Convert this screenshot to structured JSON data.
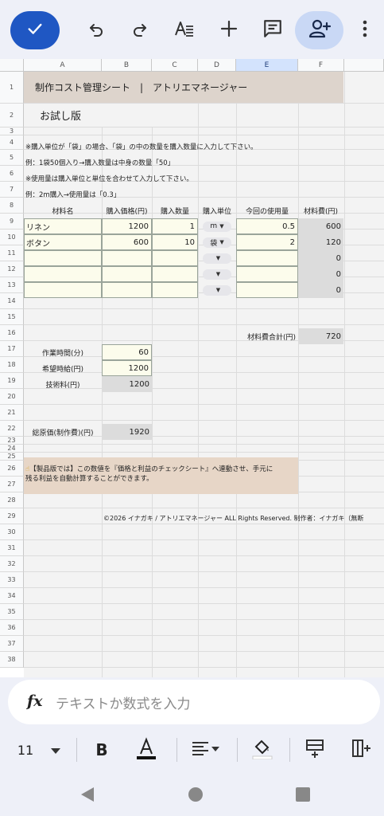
{
  "toolbar": {
    "icons": [
      "check-icon",
      "undo-icon",
      "redo-icon",
      "text-format-icon",
      "add-icon",
      "comment-icon",
      "add-person-icon",
      "more-vert-icon"
    ],
    "accent": "#1f57c3"
  },
  "columns": [
    "A",
    "B",
    "C",
    "D",
    "E",
    "F"
  ],
  "selected_column": "E",
  "rows": [
    "1",
    "2",
    "3",
    "4",
    "5",
    "6",
    "7",
    "8",
    "9",
    "10",
    "11",
    "12",
    "13",
    "14",
    "15",
    "16",
    "17",
    "18",
    "19",
    "20",
    "21",
    "22",
    "23",
    "24",
    "25",
    "26",
    "27",
    "28",
    "29",
    "30",
    "31",
    "32",
    "33",
    "34",
    "35",
    "36",
    "37",
    "38"
  ],
  "sheet": {
    "title": "制作コスト管理シート　|　アトリエマネージャー",
    "trial": "お試し版",
    "note1": "※購入単位が「袋」の場合、「袋」の中の数量を購入数量に入力して下さい。",
    "note2": "例：1袋50個入り→購入数量は中身の数量「50」",
    "note3": "※使用量は購入単位と単位を合わせて入力して下さい。",
    "note4": "例：2m購入→使用量は「0.3」",
    "headers": {
      "name": "材料名",
      "price": "購入価格(円)",
      "qty": "購入数量",
      "unit": "購入単位",
      "usage": "今回の使用量",
      "cost": "材料費(円)"
    },
    "items": [
      {
        "name": "リネン",
        "price": "1200",
        "qty": "1",
        "unit": "m",
        "usage": "0.5",
        "cost": "600"
      },
      {
        "name": "ボタン",
        "price": "600",
        "qty": "10",
        "unit": "袋",
        "usage": "2",
        "cost": "120"
      },
      {
        "name": "",
        "price": "",
        "qty": "",
        "unit": "",
        "usage": "",
        "cost": "0"
      },
      {
        "name": "",
        "price": "",
        "qty": "",
        "unit": "",
        "usage": "",
        "cost": "0"
      },
      {
        "name": "",
        "price": "",
        "qty": "",
        "unit": "",
        "usage": "",
        "cost": "0"
      }
    ],
    "material_total_label": "材料費合計(円)",
    "material_total": "720",
    "work_time_label": "作業時間(分)",
    "work_time": "60",
    "hourly_label": "希望時給(円)",
    "hourly": "1200",
    "tech_fee_label": "技術料(円)",
    "tech_fee": "1200",
    "total_label": "総原価(制作費)(円)",
    "total": "1920",
    "promo_line1": "【製品版では】この数値を『価格と利益のチェックシート』へ連動させ、手元に",
    "promo_line2": "残る利益を自動計算することができます。",
    "copyright": "©2026 イナガキ / アトリエマネージャー ALL Rights Reserved. 制作者：イナガキ（無断"
  },
  "formula_bar": {
    "icon": "fx-icon",
    "placeholder": "テキストか数式を入力"
  },
  "format_bar": {
    "font_size": "11",
    "icons": [
      "chevron-down-icon",
      "bold-icon",
      "text-color-icon",
      "align-icon",
      "fill-color-icon",
      "insert-row-icon",
      "insert-column-icon"
    ]
  },
  "nav": {
    "icons": [
      "back-icon",
      "home-icon",
      "recents-icon"
    ]
  }
}
